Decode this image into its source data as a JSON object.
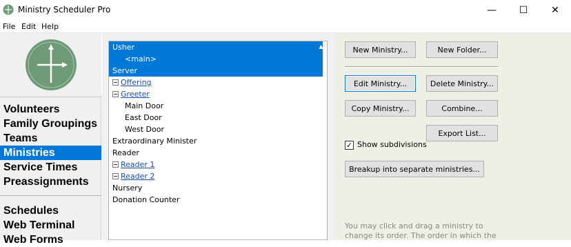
{
  "window": {
    "title": "Ministry Scheduler Pro",
    "minimize_glyph": "—",
    "maximize_glyph": "☐",
    "close_glyph": "✕"
  },
  "menu": [
    "File",
    "Edit",
    "Help"
  ],
  "sidebar": {
    "items": [
      {
        "label": "Volunteers",
        "selected": false
      },
      {
        "label": "Family Groupings",
        "selected": false
      },
      {
        "label": "Teams",
        "selected": false
      },
      {
        "label": "Ministries",
        "selected": true
      },
      {
        "label": "Service Times",
        "selected": false
      },
      {
        "label": "Preassignments",
        "selected": false
      },
      {
        "label": "Schedules",
        "selected": false
      },
      {
        "label": "Web Terminal",
        "selected": false
      },
      {
        "label": "Web Forms",
        "selected": false
      }
    ]
  },
  "tree": {
    "rows": [
      {
        "label": "Usher",
        "selected": true,
        "link": false,
        "toggle": false,
        "indent": 0
      },
      {
        "label": "<main>",
        "selected": true,
        "link": false,
        "toggle": false,
        "indent": 1
      },
      {
        "label": "Server",
        "selected": true,
        "link": false,
        "toggle": false,
        "indent": 0
      },
      {
        "label": "Offering",
        "selected": false,
        "link": true,
        "toggle": true,
        "indent": 0
      },
      {
        "label": "Greeter",
        "selected": false,
        "link": true,
        "toggle": true,
        "indent": 0
      },
      {
        "label": "Main Door",
        "selected": false,
        "link": false,
        "toggle": false,
        "indent": 1
      },
      {
        "label": "East Door",
        "selected": false,
        "link": false,
        "toggle": false,
        "indent": 1
      },
      {
        "label": "West Door",
        "selected": false,
        "link": false,
        "toggle": false,
        "indent": 1
      },
      {
        "label": "Extraordinary Minister",
        "selected": false,
        "link": false,
        "toggle": false,
        "indent": 0
      },
      {
        "label": "Reader",
        "selected": false,
        "link": false,
        "toggle": false,
        "indent": 0
      },
      {
        "label": "Reader 1",
        "selected": false,
        "link": true,
        "toggle": true,
        "indent": 0
      },
      {
        "label": "Reader 2",
        "selected": false,
        "link": true,
        "toggle": true,
        "indent": 0
      },
      {
        "label": "Nursery",
        "selected": false,
        "link": false,
        "toggle": false,
        "indent": 0
      },
      {
        "label": "Donation Counter",
        "selected": false,
        "link": false,
        "toggle": false,
        "indent": 0
      }
    ],
    "scroll_up_glyph": "▲"
  },
  "buttons": {
    "new_ministry": "New Ministry...",
    "new_folder": "New Folder...",
    "edit_ministry": "Edit Ministry...",
    "delete_ministry": "Delete Ministry...",
    "copy_ministry": "Copy Ministry...",
    "combine": "Combine...",
    "export_list": "Export List...",
    "breakup": "Breakup into separate ministries..."
  },
  "options": {
    "show_subdivisions_label": "Show subdivisions",
    "show_subdivisions_checked": true,
    "check_glyph": "✓"
  },
  "hint": {
    "line1": "You may click and drag a ministry to",
    "line2": "change its order. The order in which the"
  },
  "colors": {
    "selection": "#0078d7",
    "link": "#1a4fa8",
    "logo": "#6e9a78"
  }
}
